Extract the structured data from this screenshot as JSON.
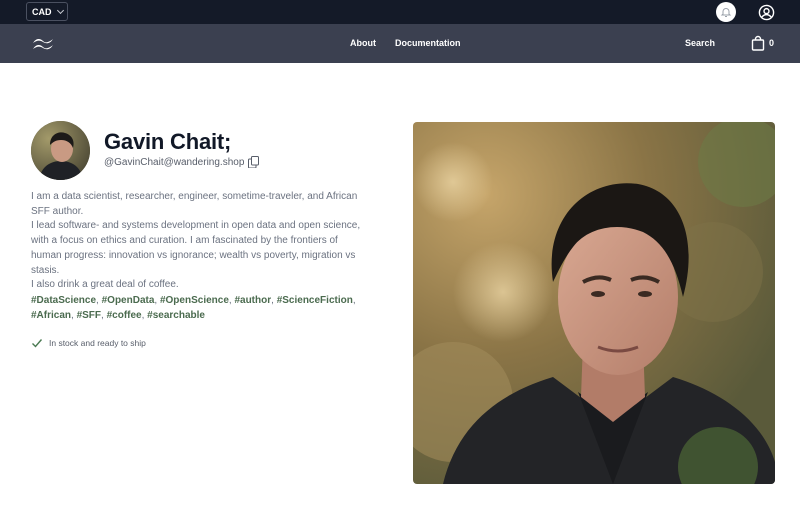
{
  "topbar": {
    "currency": "CAD",
    "icons": {
      "currency_chevron": "chevron-down-icon",
      "notifications": "bell-icon",
      "account": "user-circle-icon"
    }
  },
  "nav": {
    "logo_icon": "wave-logo-icon",
    "links": [
      "About",
      "Documentation"
    ],
    "search_label": "Search",
    "cart_icon": "shopping-bag-icon",
    "cart_count": "0"
  },
  "profile": {
    "name": "Gavin Chait;",
    "handle": "@GavinChait@wandering.shop",
    "copy_icon": "copy-icon",
    "bio_lines": [
      "I am a data scientist, researcher, engineer, sometime-traveler, and African SFF author.",
      "I lead software- and systems development in open data and open science, with a focus on ethics and curation. I am fascinated by the frontiers of human progress: innovation vs ignorance; wealth vs poverty, migration vs stasis.",
      "I also drink a great deal of coffee."
    ],
    "tags": [
      "#DataScience",
      "#OpenData",
      "#OpenScience",
      "#author",
      "#ScienceFiction",
      "#African",
      "#SFF",
      "#coffee",
      "#searchable"
    ],
    "stock_icon": "check-icon",
    "stock_text": "In stock and ready to ship"
  },
  "colors": {
    "topbar_bg": "#141a28",
    "nav_bg": "#3b4050",
    "tag": "#4b6b4f",
    "check": "#4a7a52"
  }
}
